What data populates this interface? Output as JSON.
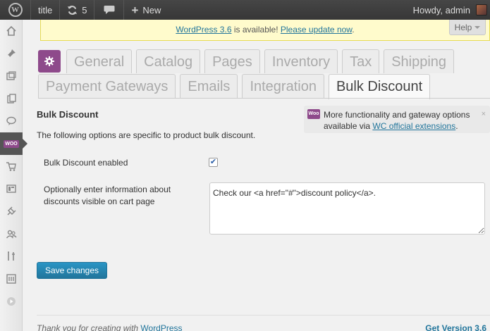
{
  "admin_bar": {
    "wp_logo": "W",
    "site_title": "title",
    "updates_count": "5",
    "new_label": "New",
    "greeting": "Howdy, admin"
  },
  "update_nag": {
    "link1": "WordPress 3.6",
    "middle": " is available! ",
    "link2": "Please update now",
    "end": "."
  },
  "help_tab": {
    "label": "Help"
  },
  "tabs_row1": [
    "General",
    "Catalog",
    "Pages",
    "Inventory",
    "Tax",
    "Shipping"
  ],
  "tabs_row2": [
    "Payment Gateways",
    "Emails",
    "Integration",
    "Bulk Discount"
  ],
  "section": {
    "title": "Bulk Discount",
    "description": "The following options are specific to product bulk discount."
  },
  "promo": {
    "logo": "Woo",
    "text1": "More functionality and gateway options available via ",
    "link": "WC official extensions",
    "text2": ".",
    "dismiss": "×"
  },
  "fields": {
    "enabled_label": "Bulk Discount enabled",
    "enabled_checked": true,
    "info_label": "Optionally enter information about discounts visible on cart page",
    "info_value": "Check our <a href=\"#\">discount policy</a>."
  },
  "save_button": "Save changes",
  "footer": {
    "thanks": "Thank you for creating with ",
    "wp_link": "WordPress",
    "version": "Get Version 3.6"
  },
  "menu_icons": [
    "dashboard-icon",
    "posts-icon",
    "media-icon",
    "pages-icon",
    "comments-icon",
    "woocommerce-icon",
    "products-icon",
    "appearance-icon",
    "plugins-icon",
    "users-icon",
    "tools-icon",
    "settings-icon",
    "collapse-icon"
  ],
  "colors": {
    "woo_purple": "#8e4a8b",
    "link_blue": "#21759b",
    "nag_bg": "#fffbcc",
    "admin_bar": "#464646"
  }
}
